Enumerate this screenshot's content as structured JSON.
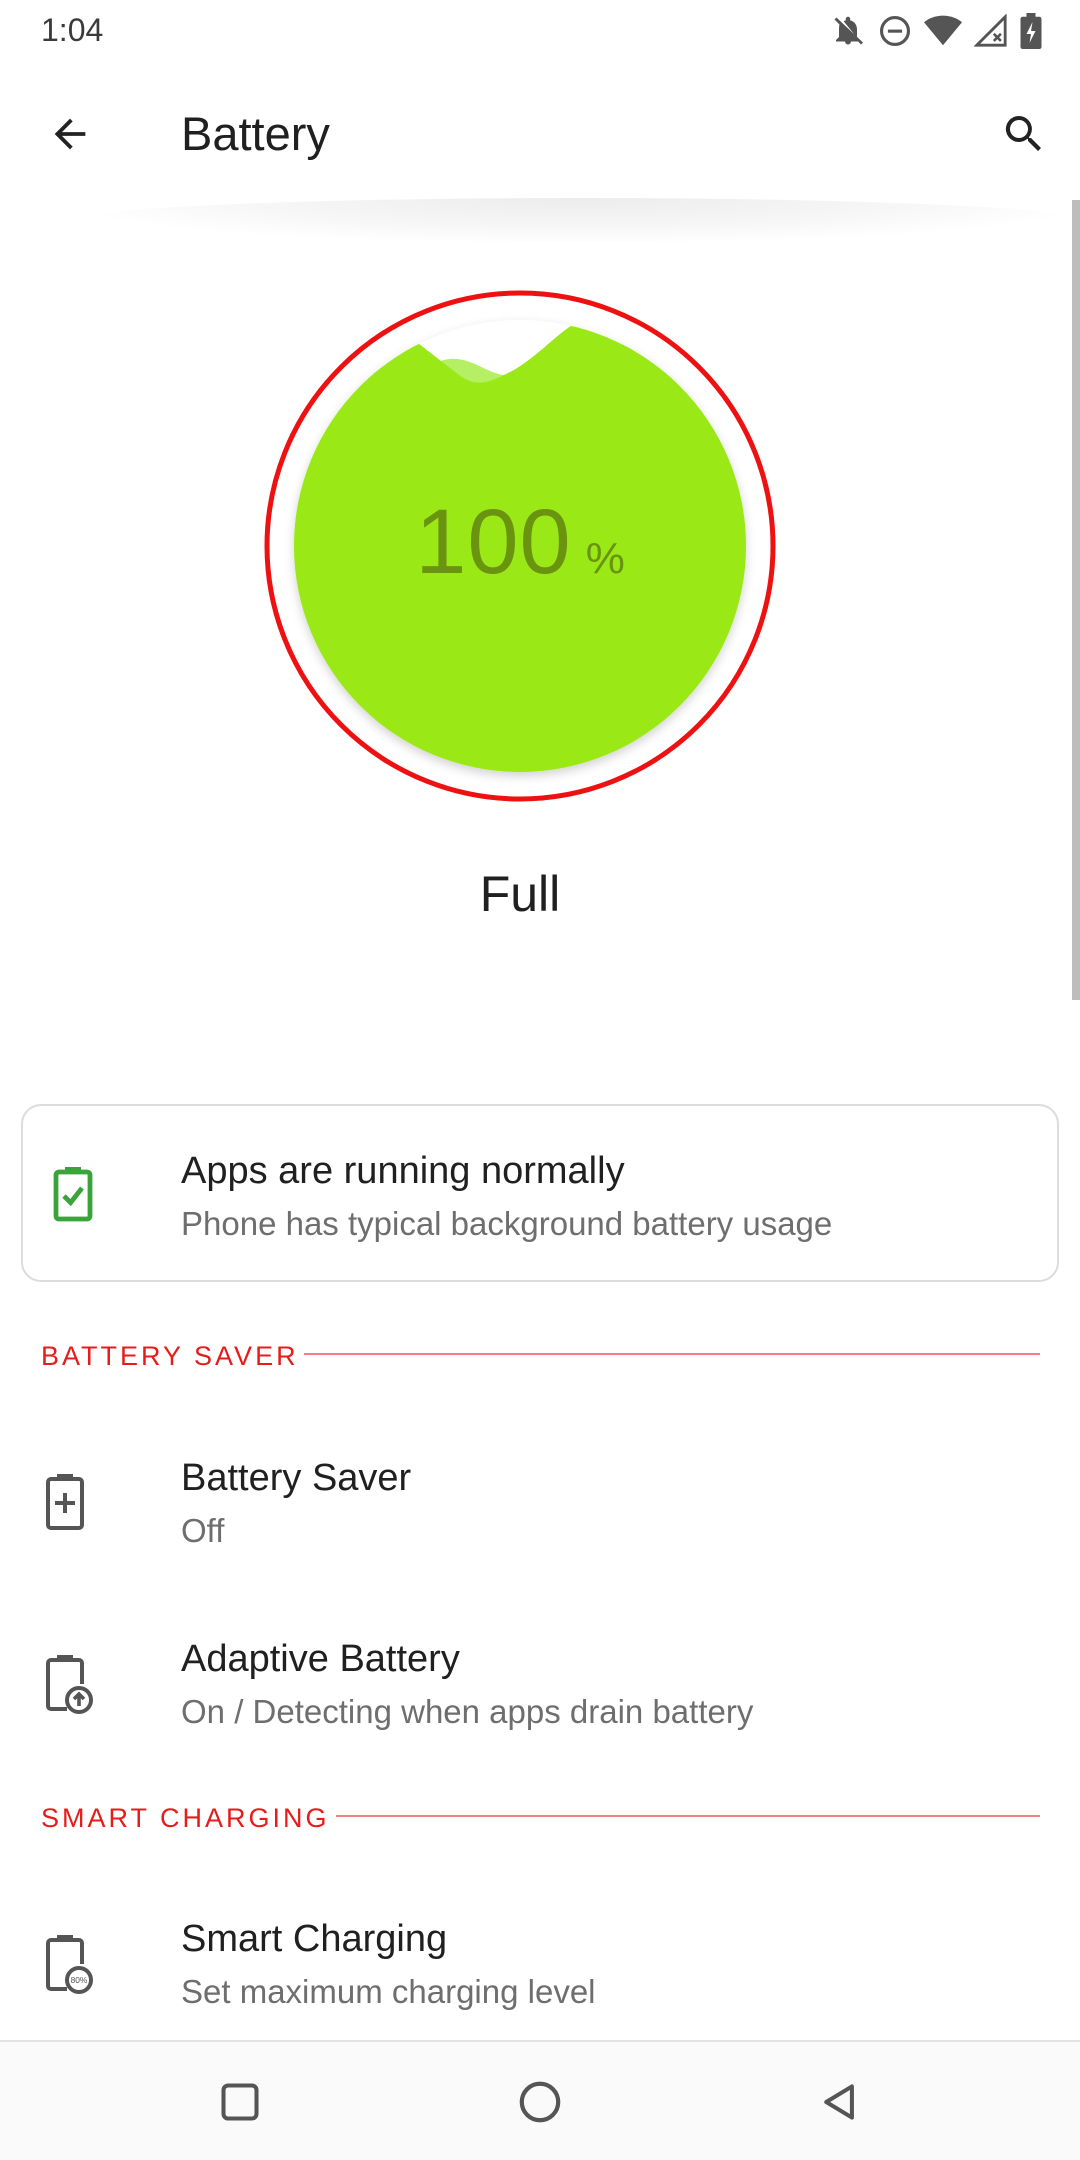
{
  "status_bar": {
    "time": "1:04",
    "icons": [
      "notifications-off-icon",
      "do-not-disturb-icon",
      "wifi-icon",
      "cellular-signal-icon",
      "battery-charging-icon"
    ]
  },
  "app_bar": {
    "title": "Battery",
    "back_icon": "arrow-back-icon",
    "search_icon": "search-icon"
  },
  "battery_gauge": {
    "level": "100",
    "unit": "%",
    "fill_percent": 100,
    "fill_color": "#9be817",
    "ring_color": "#ee1111",
    "status": "Full"
  },
  "app_status_card": {
    "title": "Apps are running normally",
    "subtitle": "Phone has typical background battery usage",
    "icon": "battery-check-icon",
    "icon_color": "#3aa33a"
  },
  "sections": {
    "battery_saver": {
      "header": "BATTERY SAVER",
      "items": [
        {
          "title": "Battery Saver",
          "subtitle": "Off",
          "icon": "battery-plus-icon"
        },
        {
          "title": "Adaptive Battery",
          "subtitle": "On / Detecting when apps drain battery",
          "icon": "adaptive-battery-icon"
        }
      ]
    },
    "smart_charging": {
      "header": "SMART CHARGING",
      "items": [
        {
          "title": "Smart Charging",
          "subtitle": "Set maximum charging level",
          "icon": "smart-charging-icon",
          "icon_badge": "80%"
        }
      ]
    }
  },
  "accent_color": "#e81b1b",
  "nav_bar": {
    "icons": [
      "recents-square-icon",
      "home-circle-icon",
      "back-triangle-icon"
    ]
  }
}
